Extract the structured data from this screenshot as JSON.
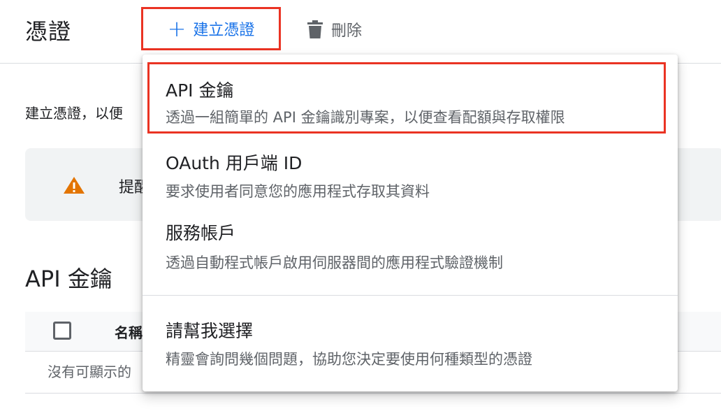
{
  "header": {
    "title": "憑證",
    "create_label": "建立憑證",
    "delete_label": "刪除"
  },
  "page": {
    "intro_text": "建立憑證，以便",
    "warning_text": "提醒",
    "section_title": "API 金鑰",
    "table": {
      "column_name": "名稱",
      "empty_text": "沒有可顯示的"
    }
  },
  "menu": {
    "items": [
      {
        "title": "API 金鑰",
        "description": "透過一組簡單的 API 金鑰識別專案，以便查看配額與存取權限"
      },
      {
        "title": "OAuth 用戶端 ID",
        "description": "要求使用者同意您的應用程式存取其資料"
      },
      {
        "title": "服務帳戶",
        "description": "透過自動程式帳戶啟用伺服器間的應用程式驗證機制"
      },
      {
        "title": "請幫我選擇",
        "description": "精靈會詢問幾個問題，協助您決定要使用何種類型的憑證"
      }
    ]
  },
  "colors": {
    "accent": "#1a73e8",
    "highlight_border": "#ea3323",
    "warning": "#e37400",
    "icon_gray": "#5f6368"
  },
  "icons": {
    "create": "plus-icon",
    "delete": "trash-icon",
    "warning": "warning-icon"
  }
}
